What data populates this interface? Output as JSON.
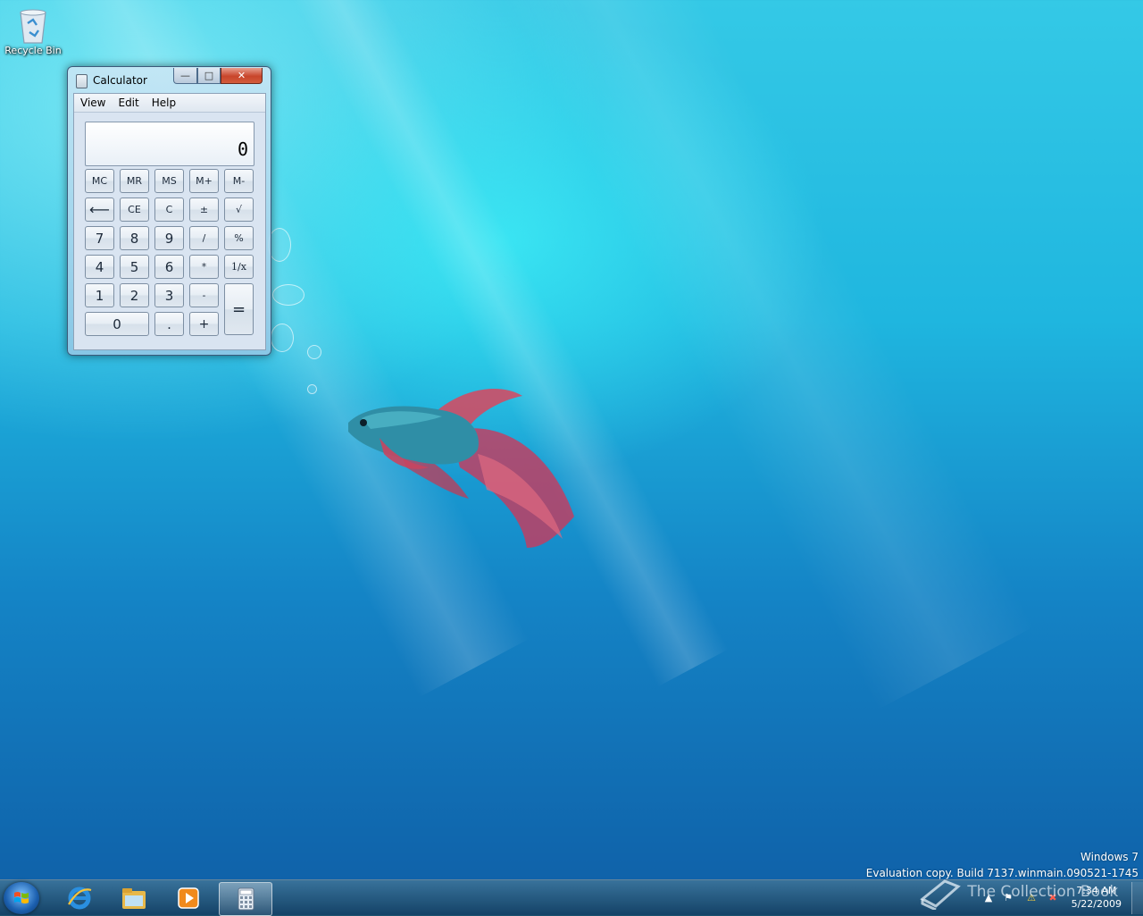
{
  "desktop": {
    "recycle_bin_label": "Recycle Bin",
    "watermark_line1": "Windows 7",
    "watermark_line2": "Evaluation copy. Build 7137.winmain.090521-1745",
    "overlay_text": "The Collection Book"
  },
  "calculator": {
    "title": "Calculator",
    "menu": [
      "View",
      "Edit",
      "Help"
    ],
    "display_value": "0",
    "controls": {
      "minimize": "—",
      "maximize": "□",
      "close": "✕"
    },
    "memory_row": [
      "MC",
      "MR",
      "MS",
      "M+",
      "M-"
    ],
    "row2": [
      "⟵",
      "CE",
      "C",
      "±",
      "√"
    ],
    "row3": [
      "7",
      "8",
      "9",
      "/",
      "%"
    ],
    "row4": [
      "4",
      "5",
      "6",
      "*",
      "1/x"
    ],
    "row5": [
      "1",
      "2",
      "3",
      "-"
    ],
    "row6": [
      "0",
      ".",
      "+"
    ],
    "equals": "="
  },
  "taskbar": {
    "pinned": [
      "internet-explorer-icon",
      "windows-explorer-icon",
      "media-player-icon",
      "calculator-icon"
    ],
    "active_app": "calculator-icon",
    "clock_time": "7:34 AM",
    "clock_date": "5/22/2009"
  },
  "colors": {
    "wallpaper_top": "#34c9e6",
    "wallpaper_bottom": "#0f5ea6",
    "close_button": "#c8452b"
  }
}
